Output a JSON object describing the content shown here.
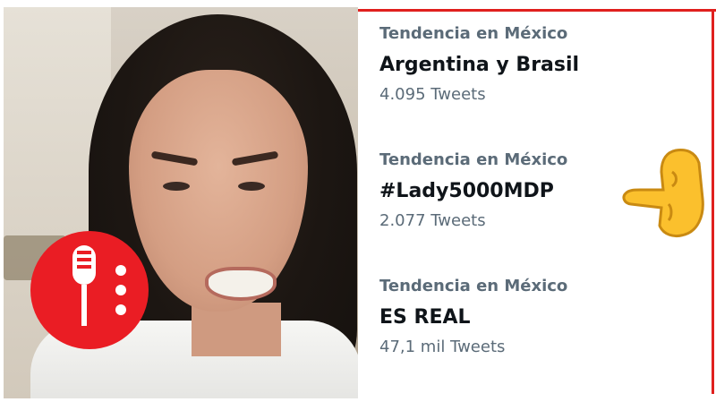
{
  "trends": [
    {
      "label": "Tendencia en México",
      "name": "Argentina y Brasil",
      "count": "4.095 Tweets"
    },
    {
      "label": "Tendencia en México",
      "name": "#Lady5000MDP",
      "count": "2.077 Tweets"
    },
    {
      "label": "Tendencia en México",
      "name": "ES REAL",
      "count": "47,1 mil Tweets"
    }
  ],
  "colors": {
    "frame": "#e0201e",
    "logo": "#ea1d24",
    "label": "#5b6b78",
    "name": "#0f1419"
  },
  "icons": {
    "logo": "microphone-icon",
    "hand": "thumbs-down-icon"
  }
}
